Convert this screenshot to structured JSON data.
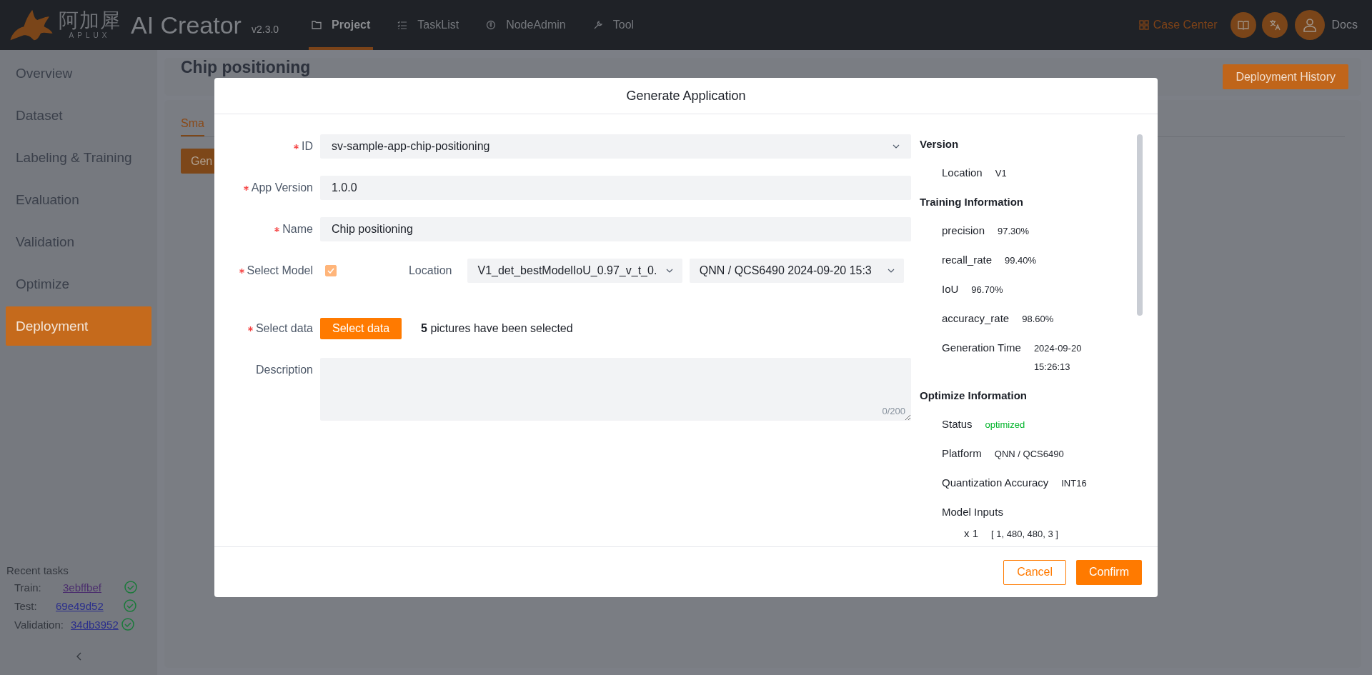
{
  "header": {
    "logo_text": "阿加犀",
    "logo_subtext": "APLUX",
    "product": "AI Creator",
    "version": "v2.3.0",
    "nav": [
      {
        "label": "Project",
        "selected": true
      },
      {
        "label": "TaskList",
        "selected": false
      },
      {
        "label": "NodeAdmin",
        "selected": false
      },
      {
        "label": "Tool",
        "selected": false
      }
    ],
    "case_center": "Case Center",
    "docs": "Docs"
  },
  "sidebar": {
    "items": [
      {
        "label": "Overview",
        "selected": false
      },
      {
        "label": "Dataset",
        "selected": false
      },
      {
        "label": "Labeling & Training",
        "selected": false
      },
      {
        "label": "Evaluation",
        "selected": false
      },
      {
        "label": "Validation",
        "selected": false
      },
      {
        "label": "Optimize",
        "selected": false
      },
      {
        "label": "Deployment",
        "selected": true
      }
    ],
    "recent_tasks": {
      "title": "Recent tasks",
      "tasks": [
        {
          "label": "Train:",
          "id": "3ebffbef",
          "visited": true,
          "done": true
        },
        {
          "label": "Test:",
          "id": "69e49d52",
          "visited": false,
          "done": true
        },
        {
          "label": "Validation:",
          "id": "34db3952",
          "visited": false,
          "done": true
        }
      ]
    }
  },
  "page": {
    "title": "Chip positioning",
    "history_button": "Deployment History",
    "tabs": [
      {
        "label": "Sma",
        "selected": true
      }
    ],
    "action_button": "Gen"
  },
  "modal": {
    "title": "Generate Application",
    "fields": [
      {
        "kind": "select",
        "label": "ID",
        "required": true,
        "value": "sv-sample-app-chip-positioning"
      },
      {
        "kind": "text",
        "label": "App Version",
        "required": true,
        "value": "1.0.0"
      },
      {
        "kind": "text",
        "label": "Name",
        "required": true,
        "value": "Chip positioning"
      },
      {
        "kind": "model",
        "label": "Select Model",
        "required": true,
        "checked": true,
        "location_label": "Location",
        "selects": [
          "V1_det_bestModelIoU_0.97_v_t_0.",
          "QNN / QCS6490 2024-09-20 15:3"
        ]
      },
      {
        "kind": "data",
        "label": "Select data",
        "required": true,
        "button": "Select data",
        "note": "**5** pictures have been selected"
      },
      {
        "kind": "textarea",
        "label": "Description",
        "required": false,
        "counter": "0/200"
      }
    ],
    "info": [
      {
        "title": "Version",
        "rows": [
          {
            "label": "Location",
            "value": "V1"
          }
        ]
      },
      {
        "title": "Training Information",
        "rows": [
          {
            "label": "precision",
            "value": "97.30%"
          },
          {
            "label": "recall_rate",
            "value": "99.40%"
          },
          {
            "label": "IoU",
            "value": "96.70%"
          },
          {
            "label": "accuracy_rate",
            "value": "98.60%"
          },
          {
            "label": "Generation Time",
            "value": "2024-09-20 15:26:13"
          }
        ]
      },
      {
        "title": "Optimize Information",
        "rows": [
          {
            "label": "Status",
            "value": "optimized",
            "kind": "status"
          },
          {
            "label": "Platform",
            "value": "QNN / QCS6490"
          },
          {
            "label": "Quantization Accuracy",
            "value": "INT16"
          },
          {
            "label": "Model Inputs"
          },
          {
            "label": "x 1",
            "value": "[ 1, 480, 480, 3 ]",
            "kind": "sub"
          }
        ]
      }
    ],
    "cancel": "Cancel",
    "confirm": "Confirm"
  }
}
